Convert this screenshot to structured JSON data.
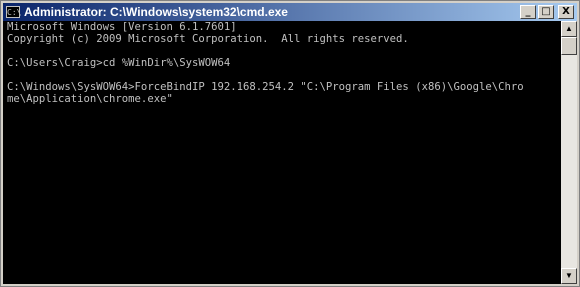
{
  "window": {
    "title": "Administrator: C:\\Windows\\system32\\cmd.exe",
    "icon_label": "C:\\"
  },
  "title_buttons": {
    "minimize_glyph": "_",
    "maximize_glyph": "□",
    "close_glyph": "X"
  },
  "scrollbar": {
    "up_glyph": "▲",
    "down_glyph": "▼"
  },
  "console": {
    "lines": [
      "Microsoft Windows [Version 6.1.7601]",
      "Copyright (c) 2009 Microsoft Corporation.  All rights reserved.",
      "",
      "C:\\Users\\Craig>cd %WinDir%\\SysWOW64",
      "",
      "C:\\Windows\\SysWOW64>ForceBindIP 192.168.254.2 \"C:\\Program Files (x86)\\Google\\Chro",
      "me\\Application\\chrome.exe\""
    ]
  },
  "colors": {
    "titlebar_start": "#0a246a",
    "titlebar_end": "#a6caf0",
    "console_bg": "#000000",
    "console_text": "#c0c0c0"
  }
}
